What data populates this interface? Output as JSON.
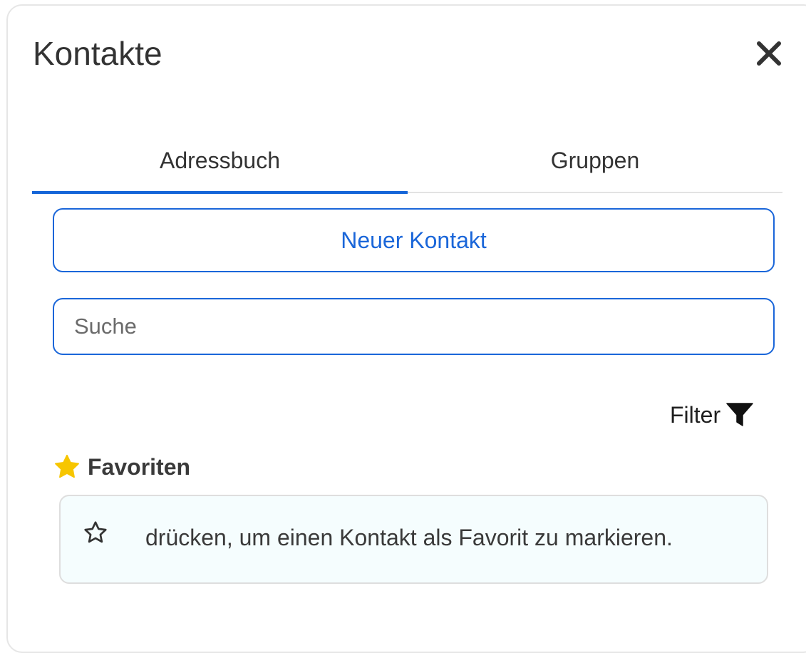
{
  "header": {
    "title": "Kontakte",
    "close_icon": "close-icon"
  },
  "tabs": [
    {
      "label": "Adressbuch",
      "active": true
    },
    {
      "label": "Gruppen",
      "active": false
    }
  ],
  "actions": {
    "new_contact_label": "Neuer Kontakt"
  },
  "search": {
    "placeholder": "Suche",
    "value": ""
  },
  "filter": {
    "label": "Filter",
    "icon": "filter-icon"
  },
  "favorites": {
    "heading": "Favoriten",
    "heading_icon": "star-filled-icon",
    "hint_icon": "star-outline-icon",
    "hint_text": "drücken, um einen Kontakt als Favorit zu markieren."
  },
  "colors": {
    "accent": "#1a66d9",
    "star": "#f7c600",
    "hint_background": "#f5fdfe"
  }
}
